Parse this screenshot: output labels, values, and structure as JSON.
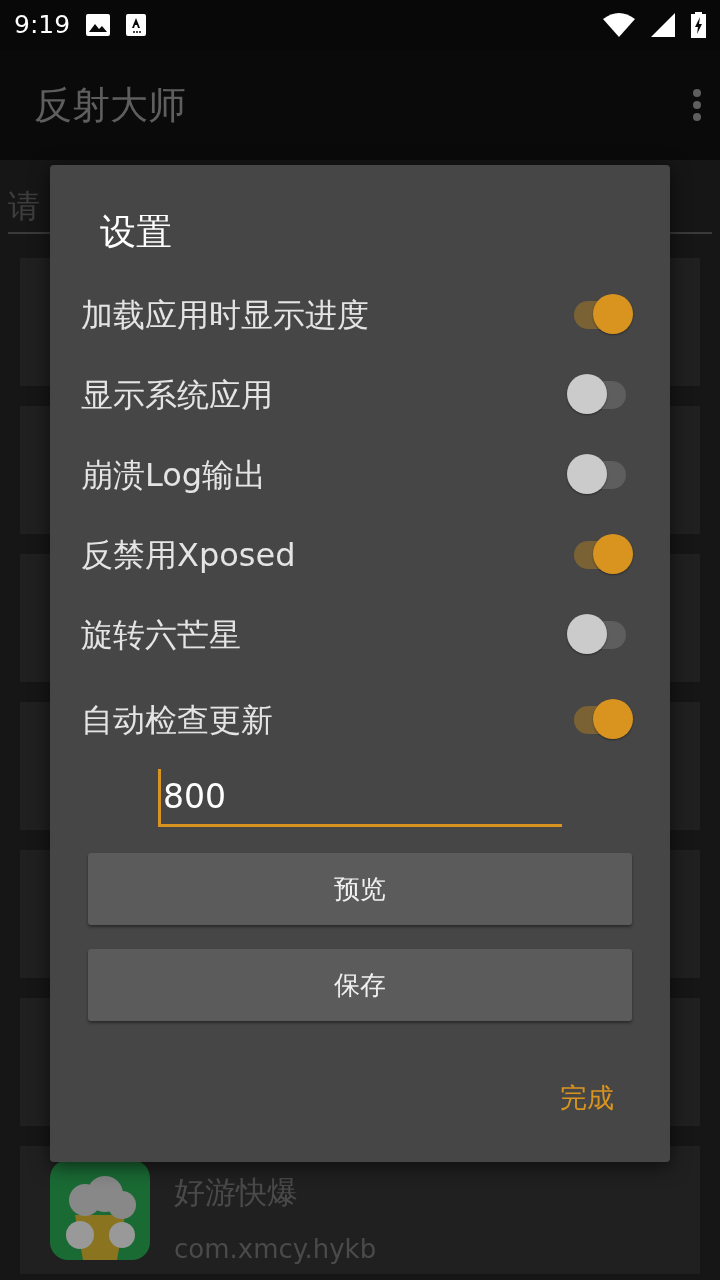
{
  "status_bar": {
    "time": "9:19"
  },
  "app_bar": {
    "title": "反射大师"
  },
  "search": {
    "placeholder": "请"
  },
  "app_list": [
    {
      "name": "好游快爆",
      "package": "com.xmcy.hykb"
    }
  ],
  "dialog": {
    "title": "设置",
    "settings": [
      {
        "kind": "toggle",
        "label": "加载应用时显示进度",
        "on": true
      },
      {
        "kind": "toggle",
        "label": "显示系统应用",
        "on": false
      },
      {
        "kind": "toggle",
        "label": "崩溃Log输出",
        "on": false
      },
      {
        "kind": "toggle",
        "label": "反禁用Xposed",
        "on": true
      },
      {
        "kind": "toggle",
        "label": "旋转六芒星",
        "on": false
      },
      {
        "kind": "toggle",
        "label": "自动检查更新",
        "on": true
      }
    ],
    "input": {
      "value": "800"
    },
    "buttons": [
      "预览",
      "保存"
    ],
    "done": "完成"
  }
}
